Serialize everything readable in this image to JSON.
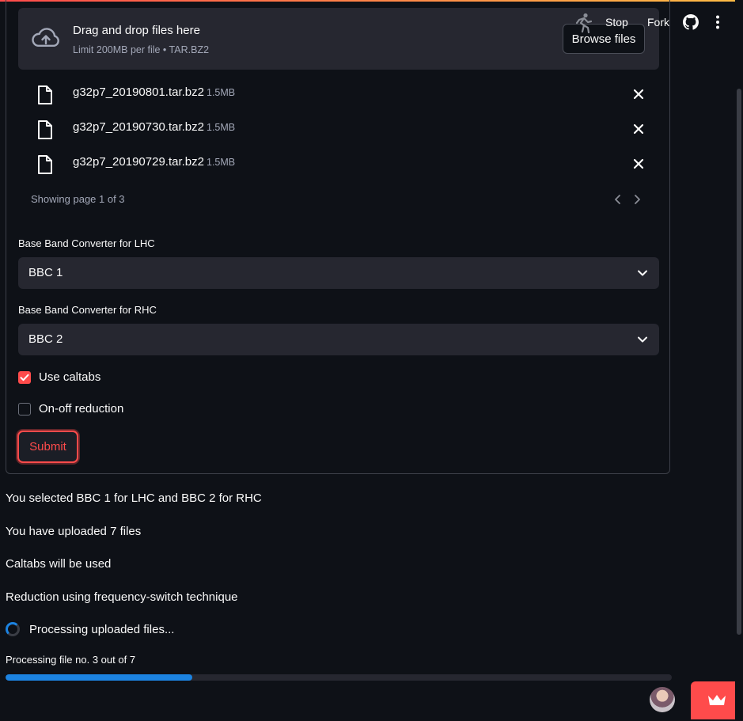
{
  "toolbar": {
    "stop_label": "Stop",
    "fork_label": "Fork"
  },
  "uploader": {
    "title": "Drag and drop files here",
    "subtitle": "Limit 200MB per file • TAR.BZ2",
    "browse_label": "Browse files",
    "files": [
      {
        "name": "g32p7_20190801.tar.bz2",
        "size": "1.5MB"
      },
      {
        "name": "g32p7_20190730.tar.bz2",
        "size": "1.5MB"
      },
      {
        "name": "g32p7_20190729.tar.bz2",
        "size": "1.5MB"
      }
    ],
    "pager_text": "Showing page 1 of 3"
  },
  "form": {
    "lhc_label": "Base Band Converter for LHC",
    "lhc_value": "BBC 1",
    "rhc_label": "Base Band Converter for RHC",
    "rhc_value": "BBC 2",
    "caltabs_label": "Use caltabs",
    "caltabs_checked": true,
    "onoff_label": "On-off reduction",
    "onoff_checked": false,
    "submit_label": "Submit"
  },
  "output": {
    "lines": [
      "You selected BBC 1 for LHC and BBC 2 for RHC",
      "You have uploaded 7 files",
      "Caltabs will be used",
      "Reduction using frequency-switch technique"
    ],
    "spinner_text": "Processing uploaded files...",
    "progress_label": "Processing file no. 3 out of 7",
    "progress_fraction": 0.28
  },
  "colors": {
    "background": "#0e1117",
    "panel": "#262730",
    "accent": "#ff4b4b",
    "progress": "#1c83e1",
    "muted_text": "#a3a8b8"
  }
}
